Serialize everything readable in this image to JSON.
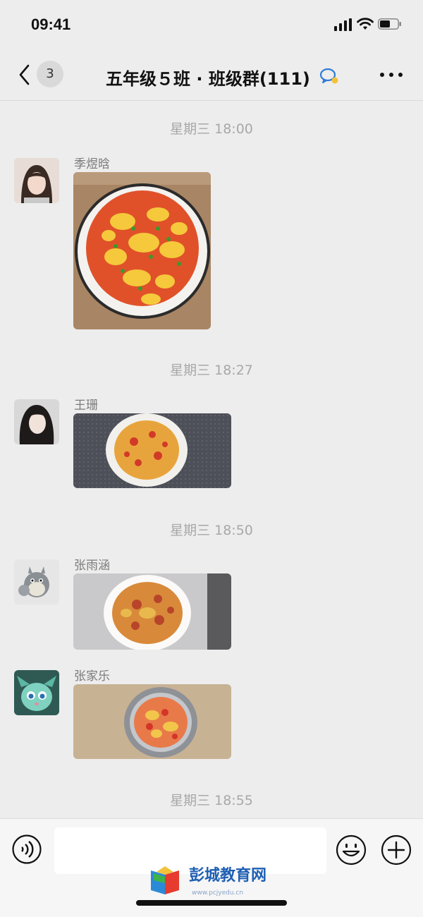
{
  "status_bar": {
    "time": "09:41"
  },
  "header": {
    "back_badge": "3",
    "title": "五年级５班 · 班级群(111)"
  },
  "messages": [
    {
      "timestamp": "星期三 18:00",
      "sender": "季煜晗",
      "photo": "tomato-egg-dish-photo"
    },
    {
      "timestamp": "星期三 18:27",
      "sender": "王珊",
      "photo": "tomato-egg-dish-photo"
    },
    {
      "timestamp": "星期三 18:50",
      "sender": "张雨涵",
      "photo": "tomato-egg-dish-photo"
    },
    {
      "timestamp": "",
      "sender": "张家乐",
      "photo": "tomato-egg-dish-photo"
    }
  ],
  "last_timestamp": "星期三 18:55",
  "input": {
    "placeholder": ""
  },
  "watermark": {
    "text": "彭城教育网",
    "url": "www.pcjyedu.cn"
  },
  "colors": {
    "background": "#ededed",
    "accent": "#2f7bd8",
    "timestamp": "#a8a8a8"
  }
}
